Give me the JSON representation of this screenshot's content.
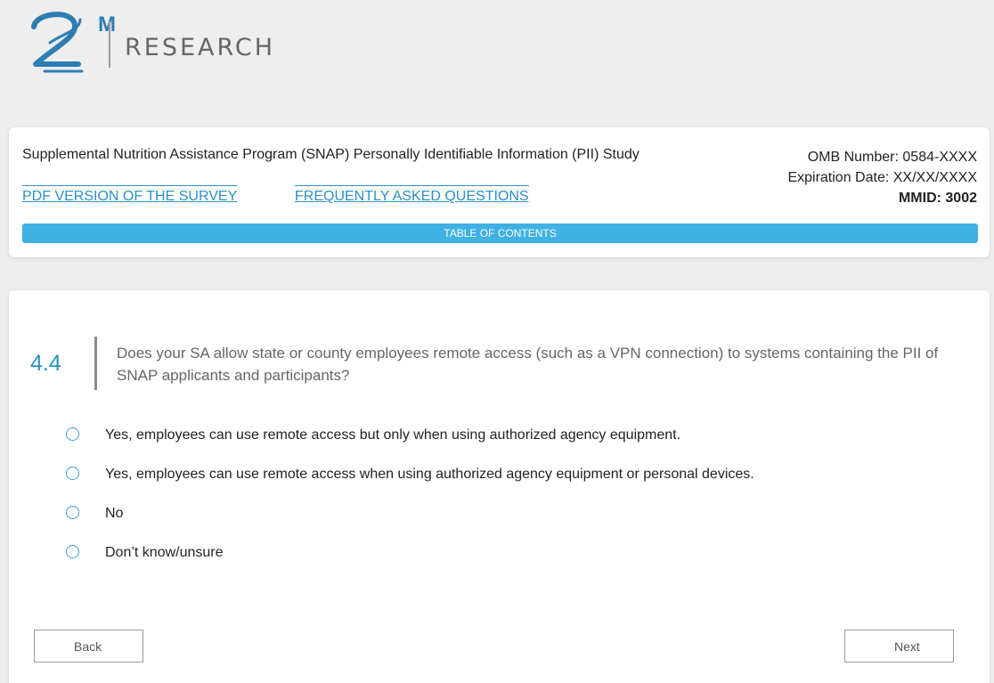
{
  "logo": {
    "superscript": "M",
    "text": "RESEARCH",
    "brand_color": "#2d7db5"
  },
  "header": {
    "study_title": "Supplemental Nutrition Assistance Program (SNAP) Personally Identifiable Information (PII) Study",
    "omb_number": "OMB Number: 0584-XXXX",
    "expiration_date": "Expiration Date: XX/XX/XXXX",
    "mmid": "MMID: 3002",
    "links": {
      "pdf_version": "PDF VERSION OF THE SURVEY",
      "faq": "FREQUENTLY ASKED QUESTIONS"
    },
    "toc_label": "TABLE OF CONTENTS",
    "accent_color": "#3fb1e3",
    "link_color": "#2b8fc7"
  },
  "question": {
    "number": "4.4",
    "text": "Does your SA allow state or county employees remote access (such as a VPN connection) to systems containing the PII of SNAP applicants and participants?",
    "options": [
      "Yes, employees can use remote access but only when using authorized agency equipment.",
      "Yes, employees can use remote access when using authorized agency equipment or personal devices.",
      "No",
      "Don’t know/unsure"
    ],
    "selected": null
  },
  "navigation": {
    "back_label": "Back",
    "next_label": "Next"
  }
}
